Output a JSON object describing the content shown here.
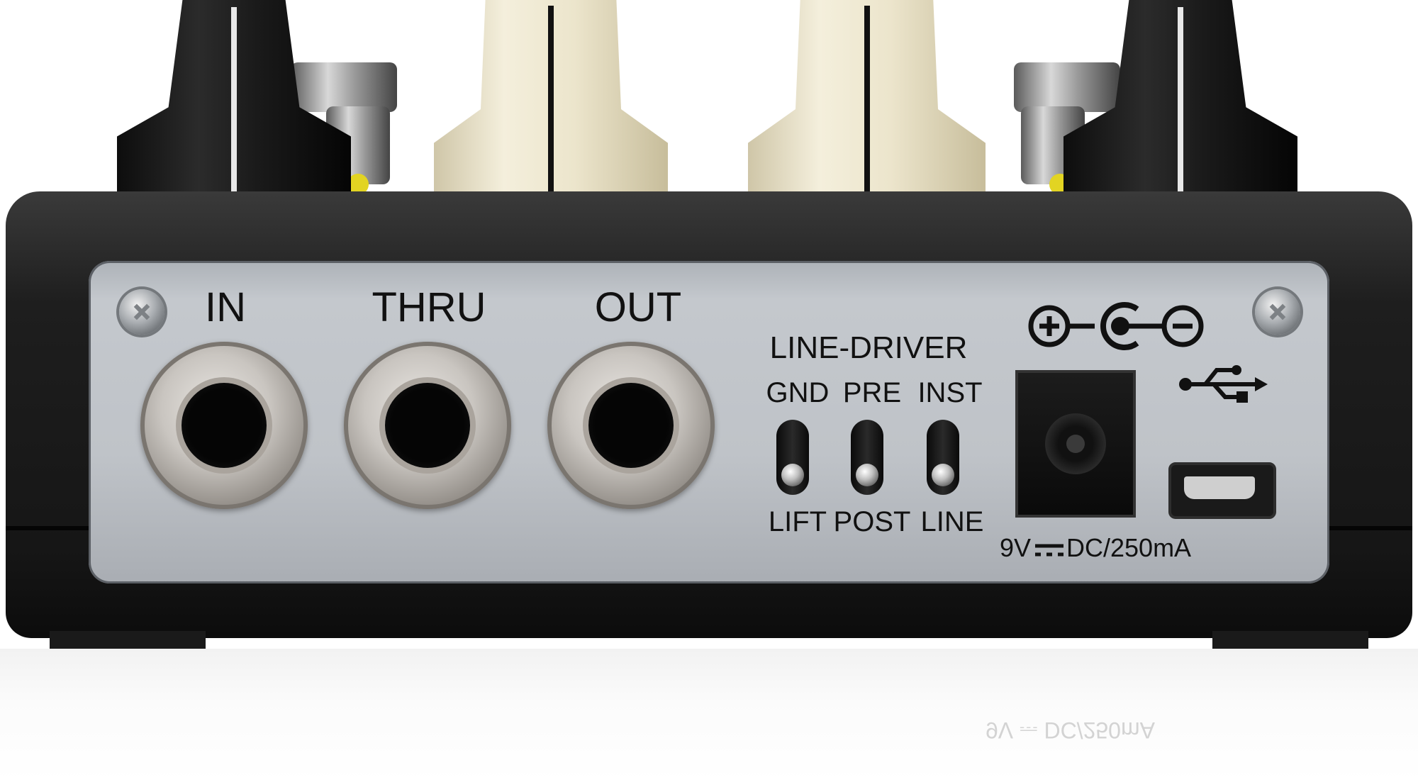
{
  "panel": {
    "jacks": [
      {
        "label": "IN"
      },
      {
        "label": "THRU"
      },
      {
        "label": "OUT"
      }
    ],
    "line_driver": {
      "title": "LINE-DRIVER",
      "switches": [
        {
          "top_label": "GND",
          "bottom_label": "LIFT"
        },
        {
          "top_label": "PRE",
          "bottom_label": "POST"
        },
        {
          "top_label": "INST",
          "bottom_label": "LINE"
        }
      ]
    },
    "power": {
      "rating": "9V",
      "rating_suffix": "DC/250mA",
      "polarity_plus": "+",
      "polarity_minus": "−"
    },
    "usb": {
      "symbol": "usb-icon"
    }
  },
  "reflection_text": "9V ⎓ DC/250mA",
  "colors": {
    "panel": "#bfc3c8",
    "chassis": "#1e1e1e",
    "knob_black": "#1a1a1a",
    "knob_cream": "#f0ead4"
  }
}
